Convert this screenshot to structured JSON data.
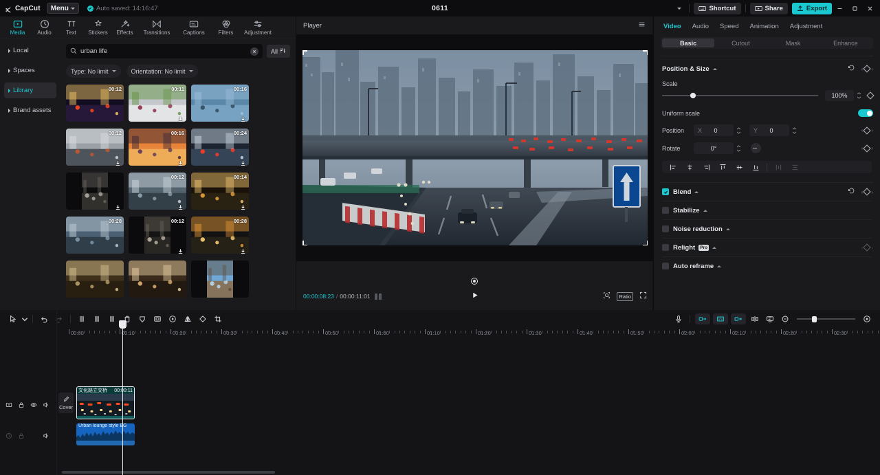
{
  "titlebar": {
    "app_name": "CapCut",
    "menu_label": "Menu",
    "autosave_text": "Auto saved: 14:16:47",
    "project_title": "0611",
    "shortcut_label": "Shortcut",
    "share_label": "Share",
    "export_label": "Export"
  },
  "media_panel": {
    "tabs": [
      {
        "label": "Media",
        "icon": "media-icon",
        "active": true
      },
      {
        "label": "Audio",
        "icon": "audio-icon",
        "active": false
      },
      {
        "label": "Text",
        "icon": "text-icon",
        "active": false
      },
      {
        "label": "Stickers",
        "icon": "stickers-icon",
        "active": false
      },
      {
        "label": "Effects",
        "icon": "effects-icon",
        "active": false
      },
      {
        "label": "Transitions",
        "icon": "transitions-icon",
        "active": false
      },
      {
        "label": "Captions",
        "icon": "captions-icon",
        "active": false
      },
      {
        "label": "Filters",
        "icon": "filters-icon",
        "active": false
      },
      {
        "label": "Adjustment",
        "icon": "adjustment-icon",
        "active": false
      }
    ],
    "nav": [
      {
        "label": "Local",
        "active": false
      },
      {
        "label": "Spaces",
        "active": false
      },
      {
        "label": "Library",
        "active": true
      },
      {
        "label": "Brand assets",
        "active": false
      }
    ],
    "search": {
      "value": "urban life",
      "placeholder": "Search",
      "all_label": "All"
    },
    "filters": [
      {
        "label": "Type: No limit"
      },
      {
        "label": "Orientation: No limit"
      }
    ],
    "grid": [
      {
        "duration": "00:12",
        "kind": "landscape",
        "desc": "night-traffic-bokeh",
        "downloadable": false
      },
      {
        "duration": "00:11",
        "kind": "landscape",
        "desc": "flowers-street",
        "downloadable": true
      },
      {
        "duration": "00:16",
        "kind": "landscape",
        "desc": "city-skyscrapers",
        "downloadable": true
      },
      {
        "duration": "00:12",
        "kind": "landscape",
        "desc": "traffic-jam-aerial",
        "downloadable": true
      },
      {
        "duration": "00:16",
        "kind": "landscape",
        "desc": "city-sunset-skyline",
        "downloadable": true
      },
      {
        "duration": "00:24",
        "kind": "landscape",
        "desc": "highway-lights",
        "downloadable": true
      },
      {
        "duration": "",
        "kind": "portrait",
        "desc": "person-crosswalk",
        "downloadable": true
      },
      {
        "duration": "00:12",
        "kind": "landscape",
        "desc": "road-aerial",
        "downloadable": true
      },
      {
        "duration": "00:14",
        "kind": "landscape",
        "desc": "night-street-lamps",
        "downloadable": true
      },
      {
        "duration": "00:28",
        "kind": "landscape",
        "desc": "construction-cranes",
        "downloadable": false
      },
      {
        "duration": "00:12",
        "kind": "portrait",
        "desc": "man-sitting",
        "downloadable": true
      },
      {
        "duration": "00:28",
        "kind": "landscape",
        "desc": "night-traffic-top",
        "downloadable": true
      },
      {
        "duration": "",
        "kind": "landscape",
        "desc": "lanterns",
        "downloadable": false
      },
      {
        "duration": "",
        "kind": "landscape",
        "desc": "bokeh-interior",
        "downloadable": false
      },
      {
        "duration": "",
        "kind": "portrait",
        "desc": "tree-sky",
        "downloadable": false
      }
    ]
  },
  "player": {
    "title": "Player",
    "current_time": "00:00:08:23",
    "total_time": "00:00:11:01",
    "separator": "/",
    "ratio_label": "Ratio"
  },
  "properties": {
    "tabs": [
      {
        "label": "Video",
        "active": true
      },
      {
        "label": "Audio",
        "active": false
      },
      {
        "label": "Speed",
        "active": false
      },
      {
        "label": "Animation",
        "active": false
      },
      {
        "label": "Adjustment",
        "active": false
      }
    ],
    "subtabs": [
      {
        "label": "Basic",
        "active": true
      },
      {
        "label": "Cutout",
        "active": false
      },
      {
        "label": "Mask",
        "active": false
      },
      {
        "label": "Enhance",
        "active": false
      }
    ],
    "position_size": {
      "title": "Position & Size",
      "scale_label": "Scale",
      "scale_value": "100%",
      "uniform_scale_label": "Uniform scale",
      "uniform_scale_on": true,
      "position_label": "Position",
      "x_axis": "X",
      "x_value": "0",
      "y_axis": "Y",
      "y_value": "0",
      "rotate_label": "Rotate",
      "rotate_value": "0°"
    },
    "sections": [
      {
        "label": "Blend",
        "checked": true,
        "pro": false,
        "has_reset": true,
        "has_keyframe": true
      },
      {
        "label": "Stabilize",
        "checked": false,
        "pro": false,
        "has_reset": false,
        "has_keyframe": false
      },
      {
        "label": "Noise reduction",
        "checked": false,
        "pro": false,
        "has_reset": false,
        "has_keyframe": false
      },
      {
        "label": "Relight",
        "checked": false,
        "pro": true,
        "pro_label": "Pro",
        "has_reset": false,
        "has_keyframe": true
      },
      {
        "label": "Auto reframe",
        "checked": false,
        "pro": false,
        "has_reset": false,
        "has_keyframe": false
      }
    ]
  },
  "timeline": {
    "ruler_labels": [
      "00:00",
      "00:10",
      "00:20",
      "00:30",
      "00:40",
      "00:50",
      "01:00",
      "01:10",
      "01:20",
      "01:30",
      "01:40",
      "01:50",
      "02:00",
      "02:10",
      "02:20",
      "02:30"
    ],
    "video_clip": {
      "name": "文化路立交桥",
      "duration": "00:00:11"
    },
    "audio_clip": {
      "name": "Urban lounge style BG"
    },
    "cover_label": "Cover",
    "zoom_percent": 26
  },
  "colors": {
    "accent": "#1ac8d0",
    "panel_bg": "#1a1a1d",
    "app_bg": "#0d0d0f",
    "timeline_bg": "#141417",
    "audio_clip": "#1565c0",
    "video_clip": "#0f5b5b"
  }
}
